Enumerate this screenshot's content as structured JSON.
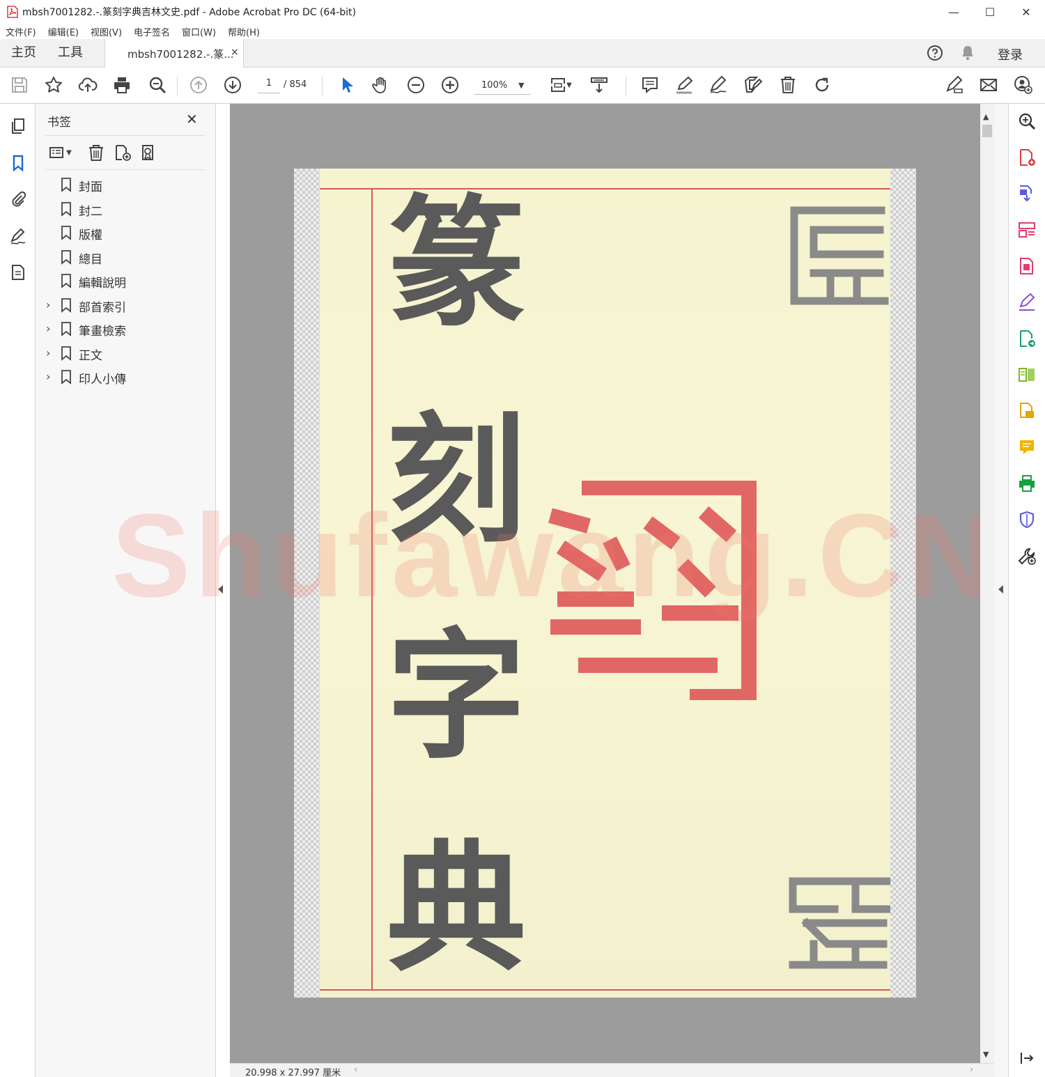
{
  "window": {
    "title": "mbsh7001282.-.篆刻字典吉林文史.pdf - Adobe Acrobat Pro DC (64-bit)",
    "minimize": "—",
    "maximize": "☐",
    "close": "✕"
  },
  "menu": [
    "文件(F)",
    "编辑(E)",
    "视图(V)",
    "电子签名",
    "窗口(W)",
    "帮助(H)"
  ],
  "tabs": {
    "home": "主页",
    "tools": "工具",
    "document": "mbsh7001282.-.篆...",
    "document_close": "×",
    "login": "登录"
  },
  "toolbar": {
    "page_current": "1",
    "page_total": "/ 854",
    "zoom": "100%",
    "zoom_caret": "▼"
  },
  "bookmarks": {
    "title": "书签",
    "close": "✕",
    "items": [
      {
        "label": "封面",
        "expandable": false
      },
      {
        "label": "封二",
        "expandable": false
      },
      {
        "label": "版權",
        "expandable": false
      },
      {
        "label": "總目",
        "expandable": false
      },
      {
        "label": "編輯說明",
        "expandable": false
      },
      {
        "label": "部首索引",
        "expandable": true
      },
      {
        "label": "筆畫檢索",
        "expandable": true
      },
      {
        "label": "正文",
        "expandable": true
      },
      {
        "label": "印人小傳",
        "expandable": true
      }
    ],
    "chevron": "›"
  },
  "document": {
    "cover_chars": [
      "篆",
      "刻",
      "字",
      "典"
    ],
    "watermark": "Shufawang.CN"
  },
  "status": {
    "page_size": "20.998 x 27.997 厘米",
    "scroll_left": "‹",
    "scroll_right": "›",
    "scroll_up": "▲",
    "scroll_down": "▼"
  },
  "colors": {
    "accent_blue": "#1a6ad8",
    "page_bg": "#f6f3cf",
    "seal_red": "#e06060",
    "ink_gray": "#5a5a5a",
    "rule_red": "#d45a5a"
  }
}
